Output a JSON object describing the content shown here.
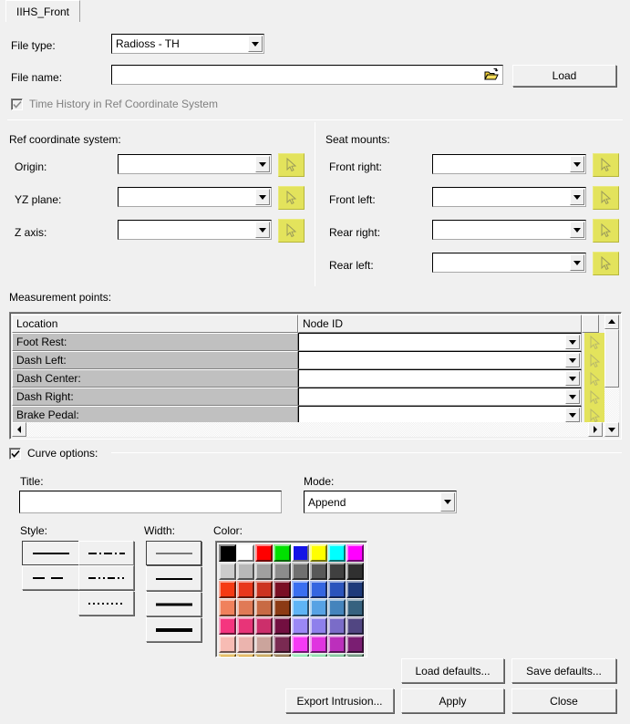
{
  "tab": {
    "label": "IIHS_Front"
  },
  "file": {
    "type_label": "File type:",
    "type_value": "Radioss - TH",
    "name_label": "File name:",
    "name_value": "",
    "browse_icon": "open-folder-icon",
    "load_button": "Load"
  },
  "time_history": {
    "label": "Time History in Ref Coordinate System",
    "checked": true,
    "enabled": false
  },
  "ref_coordinate_system": {
    "title": "Ref coordinate system:",
    "fields": [
      {
        "label": "Origin:",
        "value": ""
      },
      {
        "label": "YZ plane:",
        "value": ""
      },
      {
        "label": "Z axis:",
        "value": ""
      }
    ],
    "picker_icon": "cursor-arrow-icon"
  },
  "seat_mounts": {
    "title": "Seat mounts:",
    "fields": [
      {
        "label": "Front right:",
        "value": ""
      },
      {
        "label": "Front left:",
        "value": ""
      },
      {
        "label": "Rear right:",
        "value": ""
      },
      {
        "label": "Rear left:",
        "value": ""
      }
    ],
    "picker_icon": "cursor-arrow-icon"
  },
  "measurement_points": {
    "title": "Measurement points:",
    "columns": [
      "Location",
      "Node ID"
    ],
    "rows": [
      {
        "location": "Foot Rest:",
        "node_id": ""
      },
      {
        "location": "Dash Left:",
        "node_id": ""
      },
      {
        "location": "Dash Center:",
        "node_id": ""
      },
      {
        "location": "Dash Right:",
        "node_id": ""
      },
      {
        "location": "Brake Pedal:",
        "node_id": ""
      }
    ],
    "picker_icon": "cursor-arrow-icon",
    "scroll_up_icon": "triangle-up-icon",
    "scroll_down_icon": "triangle-down-icon",
    "scroll_left_icon": "triangle-left-icon",
    "scroll_right_icon": "triangle-right-icon"
  },
  "curve_options": {
    "label": "Curve options:",
    "checked": true,
    "title_label": "Title:",
    "title_value": "",
    "mode_label": "Mode:",
    "mode_value": "Append",
    "style_label": "Style:",
    "width_label": "Width:",
    "color_label": "Color:",
    "styles": [
      {
        "name": "solid",
        "selected": true
      },
      {
        "name": "dash-dot",
        "selected": false
      },
      {
        "name": "dashed",
        "selected": false
      },
      {
        "name": "dash-dot-dot",
        "selected": false
      },
      {
        "name": "dotted",
        "selected": false
      }
    ],
    "widths": [
      {
        "name": "width-1",
        "px": 1,
        "selected": true
      },
      {
        "name": "width-2",
        "px": 2,
        "selected": false
      },
      {
        "name": "width-3",
        "px": 3,
        "selected": false
      },
      {
        "name": "width-4",
        "px": 4,
        "selected": false
      }
    ],
    "selected_color": "#1414e6",
    "palette": [
      [
        "#000000",
        "#ffffff",
        "#ff0000",
        "#00e000",
        "#1414e6",
        "#ffff00",
        "#00ffff",
        "#ff00ff"
      ],
      [
        "#cccccc",
        "#b8b8b8",
        "#a0a0a0",
        "#8c8c8c",
        "#707070",
        "#585858",
        "#404040",
        "#303030"
      ],
      [
        "#f53a14",
        "#e8381c",
        "#cc3320",
        "#7a0f24",
        "#3a6ff0",
        "#3566e0",
        "#2b54bc",
        "#1e3a7a"
      ],
      [
        "#f0815c",
        "#e07a56",
        "#c86a44",
        "#8c3a14",
        "#5fb4f5",
        "#57a2e4",
        "#4484bc",
        "#36627f"
      ],
      [
        "#f5357f",
        "#e83478",
        "#cc2f6b",
        "#720f40",
        "#9b88f5",
        "#8e80ec",
        "#7a6cc8",
        "#514682"
      ],
      [
        "#f7bcb4",
        "#ebb4ae",
        "#cba49c",
        "#7a2a52",
        "#f53af5",
        "#e034e0",
        "#bc2fbc",
        "#7a1e72"
      ],
      [
        "#d9a020",
        "#d99a1e",
        "#b5861c",
        "#6b4a14",
        "#6ee09a",
        "#62d18c",
        "#4fae74",
        "#356b4a"
      ]
    ]
  },
  "buttons": {
    "load_defaults": "Load defaults...",
    "save_defaults": "Save defaults...",
    "export_intrusion": "Export Intrusion...",
    "apply": "Apply",
    "close": "Close"
  }
}
